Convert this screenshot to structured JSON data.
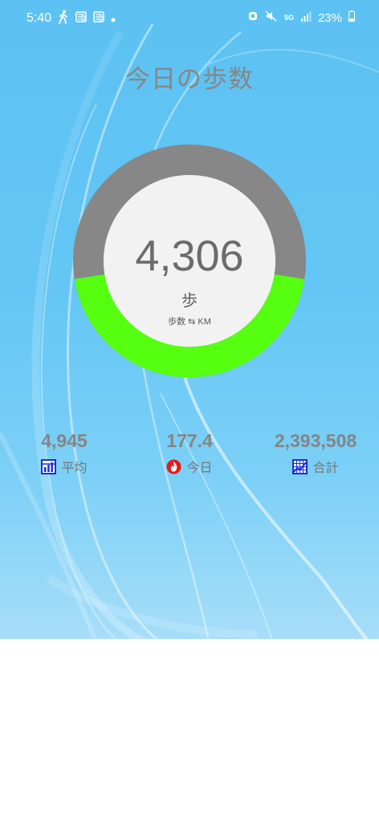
{
  "status_bar": {
    "time": "5:40",
    "network": "5G",
    "battery": "23%"
  },
  "title": "今日の歩数",
  "counter": {
    "value": "4,306",
    "unit": "歩",
    "toggle": "歩数 ⇆ KM",
    "progress_fraction": 0.45
  },
  "stats": [
    {
      "value": "4,945",
      "label": "平均",
      "icon": "chart-icon"
    },
    {
      "value": "177.4",
      "label": "今日",
      "icon": "fire-icon"
    },
    {
      "value": "2,393,508",
      "label": "合計",
      "icon": "grid-chart-icon"
    }
  ],
  "colors": {
    "background": "#5cc2f3",
    "ring_track": "#878787",
    "ring_progress": "#55ff0f",
    "inner_circle": "#f2f2f2",
    "stat_icon_blue": "#1a2fd6",
    "fire_red": "#e41b1b"
  }
}
